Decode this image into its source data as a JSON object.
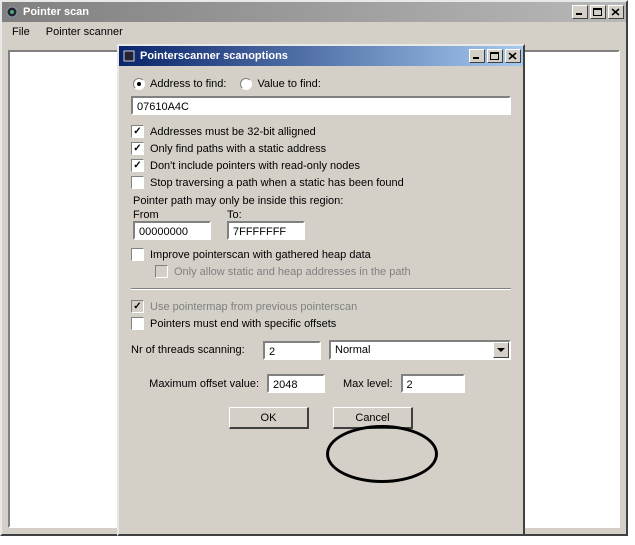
{
  "parent_window": {
    "title": "Pointer scan",
    "menu": {
      "file": "File",
      "pointer_scanner": "Pointer scanner"
    }
  },
  "dialog": {
    "title": "Pointerscanner scanoptions",
    "radio": {
      "address_to_find": "Address to find:",
      "value_to_find": "Value to find:"
    },
    "address_value": "07610A4C",
    "checks": {
      "aligned32": "Addresses must be 32-bit alligned",
      "static_only": "Only find paths with a static address",
      "no_readonly": "Don't include pointers with read-only nodes",
      "stop_on_static": "Stop traversing a path when a static has been found"
    },
    "region": {
      "label": "Pointer path may only be inside this region:",
      "from_label": "From",
      "to_label": "To:",
      "from": "00000000",
      "to": "7FFFFFFF"
    },
    "heap": {
      "improve": "Improve pointerscan with gathered heap data",
      "only_static_heap": "Only allow static and heap addresses in the path"
    },
    "pointermap": "Use pointermap from previous pointerscan",
    "end_offsets": "Pointers must end with specific offsets",
    "threads": {
      "label": "Nr of threads scanning:",
      "value": "2",
      "priority": "Normal"
    },
    "max_offset": {
      "label": "Maximum offset value:",
      "value": "2048"
    },
    "max_level": {
      "label": "Max level:",
      "value": "2"
    },
    "buttons": {
      "ok": "OK",
      "cancel": "Cancel"
    }
  }
}
